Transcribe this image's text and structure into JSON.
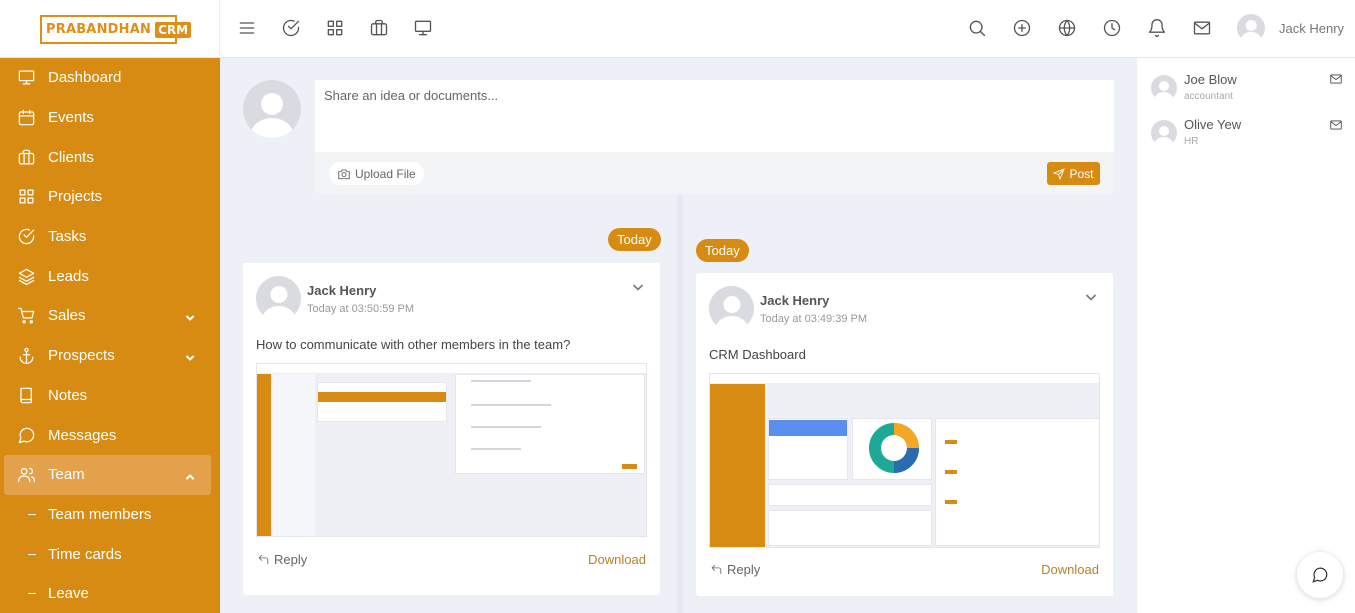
{
  "brand": {
    "name": "PRABANDHAN",
    "badge": "CRM"
  },
  "topbar": {
    "user_name": "Jack Henry",
    "left_icons": [
      "menu-icon",
      "check-circle-icon",
      "grid-icon",
      "briefcase-icon",
      "monitor-icon"
    ],
    "right_icons": [
      "search-icon",
      "plus-circle-icon",
      "globe-icon",
      "clock-icon",
      "bell-icon",
      "mail-icon"
    ]
  },
  "sidebar": {
    "items": [
      {
        "label": "Dashboard",
        "icon": "monitor-icon"
      },
      {
        "label": "Events",
        "icon": "calendar-icon"
      },
      {
        "label": "Clients",
        "icon": "briefcase-icon"
      },
      {
        "label": "Projects",
        "icon": "grid-icon"
      },
      {
        "label": "Tasks",
        "icon": "check-circle-icon"
      },
      {
        "label": "Leads",
        "icon": "layers-icon"
      },
      {
        "label": "Sales",
        "icon": "cart-icon"
      },
      {
        "label": "Prospects",
        "icon": "anchor-icon"
      },
      {
        "label": "Notes",
        "icon": "book-icon"
      },
      {
        "label": "Messages",
        "icon": "message-circle-icon"
      },
      {
        "label": "Team",
        "icon": "users-icon"
      }
    ],
    "subitems": [
      "Team members",
      "Time cards",
      "Leave"
    ]
  },
  "composer": {
    "placeholder": "Share an idea or documents...",
    "upload_label": "Upload File",
    "post_label": "Post"
  },
  "timeline": {
    "posts": [
      {
        "date_badge": "Today",
        "author": "Jack Henry",
        "time": "Today at 03:50:59 PM",
        "message": "How to communicate with other members in the team?",
        "reply_label": "Reply",
        "download_label": "Download"
      },
      {
        "date_badge": "Today",
        "author": "Jack Henry",
        "time": "Today at 03:49:39 PM",
        "message": "CRM Dashboard",
        "reply_label": "Reply",
        "download_label": "Download"
      }
    ]
  },
  "team_panel": {
    "members": [
      {
        "name": "Joe Blow",
        "role": "accountant"
      },
      {
        "name": "Olive Yew",
        "role": "HR"
      }
    ]
  },
  "colors": {
    "accent": "#d88b12",
    "background": "#eef0f8",
    "download_link": "#b9802a"
  }
}
